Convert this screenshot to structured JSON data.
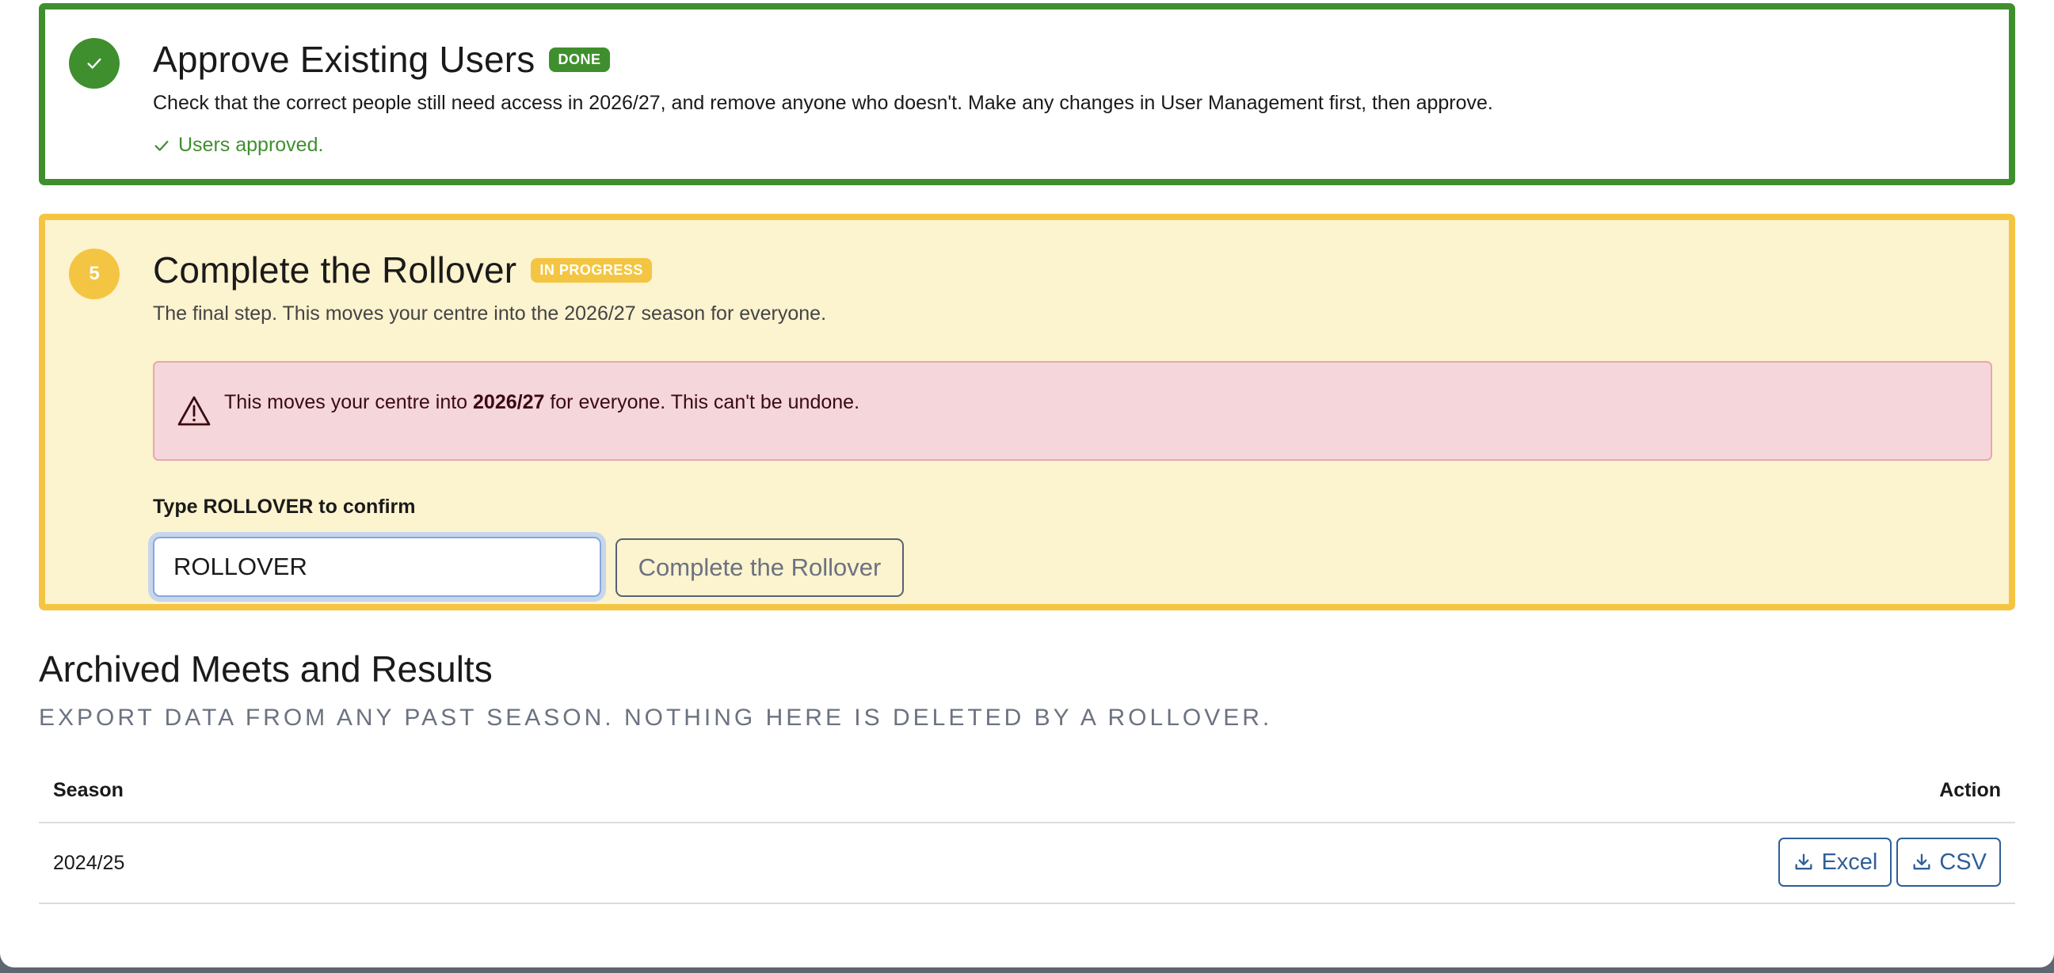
{
  "steps": {
    "approve": {
      "title": "Approve Existing Users",
      "badge": "DONE",
      "description": "Check that the correct people still need access in 2026/27, and remove anyone who doesn't. Make any changes in User Management first, then approve.",
      "status_message": "Users approved.",
      "icon": "check-icon",
      "color": "#3f8f2e"
    },
    "rollover": {
      "number": "5",
      "title": "Complete the Rollover",
      "badge": "IN PROGRESS",
      "description": "The final step. This moves your centre into the 2026/27 season for everyone.",
      "alert": {
        "icon": "warning-triangle-icon",
        "text_before": "This moves your centre into ",
        "text_bold": "2026/27",
        "text_after": " for everyone. This can't be undone."
      },
      "confirm_label": "Type ROLLOVER to confirm",
      "confirm_value": "ROLLOVER",
      "complete_button_label": "Complete the Rollover",
      "color": "#f4c542"
    }
  },
  "archived": {
    "title": "Archived Meets and Results",
    "subtitle": "EXPORT DATA FROM ANY PAST SEASON. NOTHING HERE IS DELETED BY A ROLLOVER.",
    "columns": {
      "season": "Season",
      "action": "Action"
    },
    "rows": [
      {
        "season": "2024/25",
        "excel_label": "Excel",
        "csv_label": "CSV"
      }
    ]
  }
}
